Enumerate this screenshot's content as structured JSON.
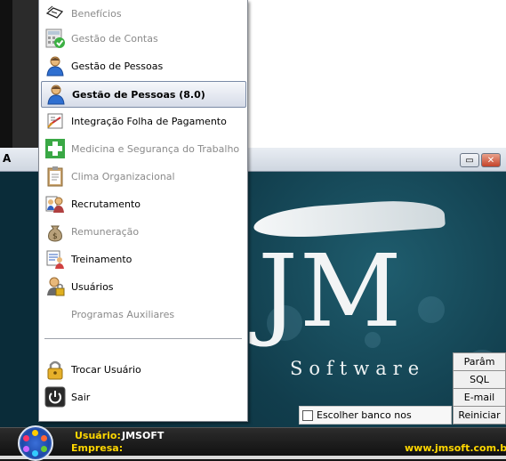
{
  "window": {
    "title_initial": "A",
    "minimize_glyph": "▭",
    "close_glyph": "✕"
  },
  "logo": {
    "mark": "JM",
    "wordmark": "Software"
  },
  "side_buttons": [
    "Parâm",
    "SQL",
    "E-mail",
    "Reiniciar"
  ],
  "choose_db_label": "Escolher banco nos módulos?",
  "menu": {
    "items": [
      {
        "label": "Benefícios",
        "disabled": true,
        "icon": "benefits-icon"
      },
      {
        "label": "Gestão de Contas",
        "disabled": true,
        "icon": "accounts-icon"
      },
      {
        "label": "Gestão de Pessoas",
        "disabled": false,
        "icon": "person-icon"
      },
      {
        "label": "Gestão de Pessoas (8.0)",
        "disabled": false,
        "selected": true,
        "icon": "person-icon"
      },
      {
        "label": "Integração Folha de Pagamento",
        "disabled": false,
        "icon": "payroll-icon"
      },
      {
        "label": "Medicina e Segurança do Trabalho",
        "disabled": true,
        "icon": "medical-cross-icon"
      },
      {
        "label": "Clima Organizacional",
        "disabled": true,
        "icon": "clipboard-icon"
      },
      {
        "label": "Recrutamento",
        "disabled": false,
        "icon": "recruit-icon"
      },
      {
        "label": "Remuneração",
        "disabled": true,
        "icon": "money-bag-icon"
      },
      {
        "label": "Treinamento",
        "disabled": false,
        "icon": "training-icon"
      },
      {
        "label": "Usuários",
        "disabled": false,
        "icon": "user-lock-icon"
      },
      {
        "label": "Programas Auxiliares",
        "disabled": true,
        "icon": ""
      }
    ],
    "bottom_items": [
      {
        "label": "Trocar Usuário",
        "icon": "padlock-icon"
      },
      {
        "label": "Sair",
        "icon": "power-icon"
      }
    ]
  },
  "status": {
    "user_label": "Usuário:",
    "user_value": "JMSOFT",
    "company_label": "Empresa:",
    "company_value": "",
    "website": "www.jmsoft.com.br"
  },
  "colors": {
    "status_text": "#ffd700",
    "background_dark": "#0e3443",
    "menu_selected_border": "#7a8aa6"
  }
}
